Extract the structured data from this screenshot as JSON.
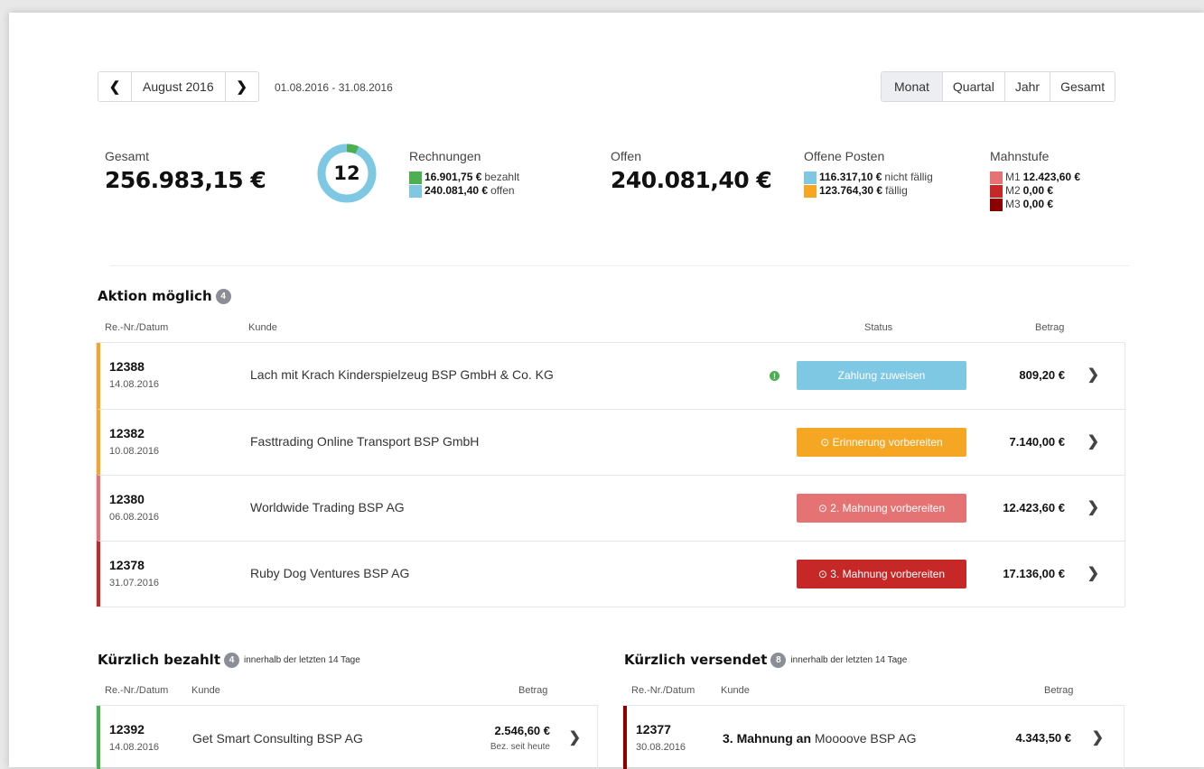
{
  "nav": {
    "prev_icon": "chevron-left-icon",
    "month": "August 2016",
    "next_icon": "chevron-right-icon",
    "range": "01.08.2016 - 31.08.2016",
    "prev_glyph": "❮",
    "next_glyph": "❯"
  },
  "period_tabs": [
    "Monat",
    "Quartal",
    "Jahr",
    "Gesamt"
  ],
  "period_selected": "Monat",
  "summary": {
    "gesamt_label": "Gesamt",
    "gesamt_value": "256.983,15 €",
    "invoice_count": "12",
    "rechnungen_label": "Rechnungen",
    "rechnungen": [
      {
        "amount": "16.901,75 €",
        "text": "bezahlt",
        "color": "#4caf50"
      },
      {
        "amount": "240.081,40 €",
        "text": "offen",
        "color": "#7ec8e3"
      }
    ],
    "offen_label": "Offen",
    "offen_value": "240.081,40 €",
    "posten_label": "Offene Posten",
    "posten": [
      {
        "amount": "116.317,10 €",
        "text": "nicht fällig",
        "color": "#7ec8e3"
      },
      {
        "amount": "123.764,30 €",
        "text": "fällig",
        "color": "#f5a623"
      }
    ],
    "mahnstufe_label": "Mahnstufe",
    "mahnstufe": [
      {
        "level": "M1",
        "amount": "12.423,60 €",
        "color": "#e57373"
      },
      {
        "level": "M2",
        "amount": "0,00 €",
        "color": "#c62828"
      },
      {
        "level": "M3",
        "amount": "0,00 €",
        "color": "#8b0000"
      }
    ],
    "donut_paid_fraction": 0.066
  },
  "aktion": {
    "title": "Aktion möglich",
    "count": "4",
    "col_nr": "Re.-Nr./Datum",
    "col_kunde": "Kunde",
    "col_status": "Status",
    "col_betrag": "Betrag",
    "rows": [
      {
        "nr": "12388",
        "date": "14.08.2016",
        "customer": "Lach mit Krach Kinderspielzeug BSP GmbH & Co. KG",
        "warn": "!",
        "status": "Zahlung zuweisen",
        "status_color": "#7ec8e3",
        "border": "#f5a623",
        "amount": "809,20 €"
      },
      {
        "nr": "12382",
        "date": "10.08.2016",
        "customer": "Fasttrading Online Transport BSP GmbH",
        "warn": "",
        "status": "⊙ Erinnerung vorbereiten",
        "status_color": "#f5a623",
        "border": "#f5a623",
        "amount": "7.140,00 €"
      },
      {
        "nr": "12380",
        "date": "06.08.2016",
        "customer": "Worldwide Trading BSP AG",
        "warn": "",
        "status": "⊙ 2. Mahnung vorbereiten",
        "status_color": "#e57373",
        "border": "#e57373",
        "amount": "12.423,60 €"
      },
      {
        "nr": "12378",
        "date": "31.07.2016",
        "customer": "Ruby Dog Ventures BSP AG",
        "warn": "",
        "status": "⊙ 3. Mahnung vorbereiten",
        "status_color": "#c62828",
        "border": "#c62828",
        "amount": "17.136,00 €"
      }
    ]
  },
  "bezahlt": {
    "title": "Kürzlich bezahlt",
    "count": "4",
    "note": "innerhalb der letzten 14 Tage",
    "col_nr": "Re.-Nr./Datum",
    "col_kunde": "Kunde",
    "col_betrag": "Betrag",
    "row": {
      "nr": "12392",
      "date": "14.08.2016",
      "customer": "Get Smart Consulting BSP AG",
      "amount": "2.546,60 €",
      "sub": "Bez. seit heute",
      "border": "#4caf50"
    }
  },
  "versendet": {
    "title": "Kürzlich versendet",
    "count": "8",
    "note": "innerhalb der letzten 14 Tage",
    "col_nr": "Re.-Nr./Datum",
    "col_kunde": "Kunde",
    "col_betrag": "Betrag",
    "row": {
      "nr": "12377",
      "date": "30.08.2016",
      "prefix": "3. Mahnung an",
      "customer": "Moooove BSP AG",
      "amount": "4.343,50 €",
      "border": "#8b0000"
    }
  },
  "chevron": "❯"
}
